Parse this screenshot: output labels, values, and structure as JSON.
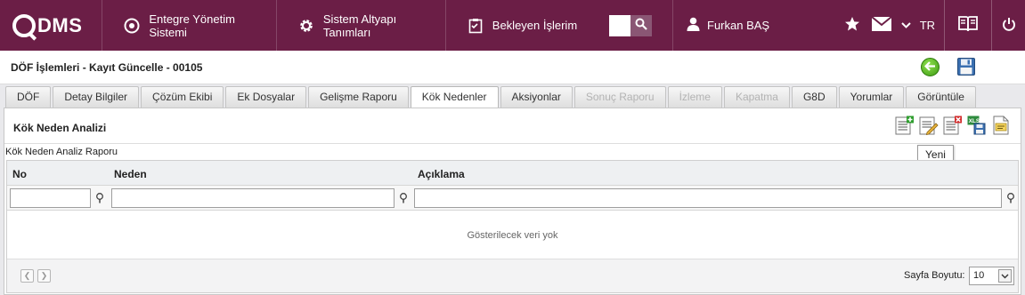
{
  "topbar": {
    "logo": "DMS",
    "nav": [
      {
        "label": "Entegre Yönetim Sistemi"
      },
      {
        "label": "Sistem Altyapı Tanımları"
      },
      {
        "label": "Bekleyen İşlerim"
      }
    ],
    "user": "Furkan BAŞ",
    "language": "TR"
  },
  "page": {
    "title": "DÖF İşlemleri - Kayıt Güncelle - 00105"
  },
  "tabs": [
    {
      "label": "DÖF",
      "state": "normal"
    },
    {
      "label": "Detay Bilgiler",
      "state": "normal"
    },
    {
      "label": "Çözüm Ekibi",
      "state": "normal"
    },
    {
      "label": "Ek Dosyalar",
      "state": "normal"
    },
    {
      "label": "Gelişme Raporu",
      "state": "normal"
    },
    {
      "label": "Kök Nedenler",
      "state": "active"
    },
    {
      "label": "Aksiyonlar",
      "state": "normal"
    },
    {
      "label": "Sonuç Raporu",
      "state": "disabled"
    },
    {
      "label": "İzleme",
      "state": "disabled"
    },
    {
      "label": "Kapatma",
      "state": "disabled"
    },
    {
      "label": "G8D",
      "state": "normal"
    },
    {
      "label": "Yorumlar",
      "state": "normal"
    },
    {
      "label": "Görüntüle",
      "state": "normal"
    }
  ],
  "panel": {
    "title": "Kök Neden Analizi",
    "tooltip": "Yeni",
    "report_label": "Kök Neden Analiz Raporu"
  },
  "grid": {
    "columns": {
      "no": "No",
      "neden": "Neden",
      "aciklama": "Açıklama"
    },
    "empty_text": "Gösterilecek veri yok",
    "page_size_label": "Sayfa Boyutu:",
    "page_size": "10"
  },
  "colors": {
    "topbar": "#6b1e46",
    "accent_green": "#3d9b13"
  }
}
